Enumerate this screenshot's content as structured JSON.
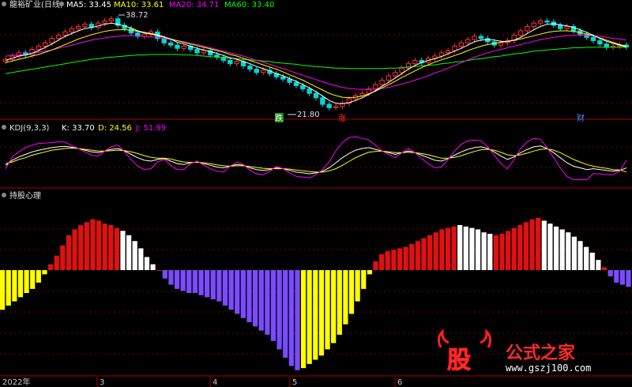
{
  "header": {
    "stock": "龍裕矿业(日线)",
    "ma5": "MA5: 33.45",
    "ma10": "MA10: 33.61",
    "ma20": "MA20: 34.71",
    "ma60": "MA60: 33.40",
    "high_label": "38.72",
    "low_label": "21.80",
    "markers": [
      "跌",
      "涨",
      "财"
    ]
  },
  "kdj": {
    "title": "KDJ(9,3,3)",
    "k": "K: 33.70",
    "d": "D: 24.56",
    "j": "J: 51.99"
  },
  "indicator": {
    "title": "持股心理"
  },
  "date_axis": [
    "2022年",
    "3",
    "4",
    "5",
    "6"
  ],
  "logo": {
    "char": "股",
    "text": "公式之家",
    "url": "www.gszj100.com"
  },
  "colors": {
    "up": "#ff3030",
    "down": "#00d8d8",
    "ma5": "#ffffff",
    "ma10": "#ffff00",
    "ma20": "#ff00ff",
    "ma60": "#00ff00",
    "hist_pos": "#e01010",
    "hist_pos_weak": "#ffffff",
    "hist_neg": "#7a4cff",
    "hist_neg_weak": "#ffff00",
    "divider": "#aa0000"
  },
  "chart_data": [
    {
      "type": "candlestick",
      "title": "",
      "note": "daily price panel with moving averages",
      "high": 38.72,
      "low": 21.8,
      "ylim": [
        21.0,
        40.0
      ],
      "close": [
        31.2,
        31.8,
        32.4,
        32.0,
        33.0,
        33.6,
        34.2,
        35.0,
        35.6,
        36.2,
        36.8,
        37.2,
        37.6,
        37.0,
        37.8,
        38.2,
        38.6,
        37.4,
        36.8,
        36.0,
        35.4,
        35.8,
        36.2,
        35.0,
        34.2,
        33.8,
        33.2,
        33.6,
        33.0,
        32.4,
        32.8,
        32.0,
        31.6,
        31.0,
        30.4,
        30.8,
        30.0,
        29.4,
        28.8,
        29.2,
        28.6,
        28.0,
        27.6,
        27.0,
        26.4,
        25.8,
        25.0,
        24.2,
        23.0,
        22.4,
        22.6,
        23.2,
        24.0,
        24.6,
        25.0,
        25.8,
        26.6,
        27.4,
        28.2,
        28.8,
        29.6,
        30.4,
        31.0,
        30.6,
        31.4,
        31.8,
        32.4,
        32.8,
        33.6,
        34.2,
        34.8,
        35.4,
        35.0,
        34.4,
        33.8,
        34.2,
        34.6,
        35.6,
        36.4,
        37.2,
        37.8,
        38.2,
        38.0,
        37.4,
        36.8,
        37.2,
        36.4,
        35.8,
        35.2,
        34.6,
        34.0,
        33.4,
        33.6,
        33.8,
        33.45
      ],
      "ma5": [
        31.0,
        31.4,
        31.8,
        32.0,
        32.3,
        32.8,
        33.4,
        34.0,
        34.7,
        35.4,
        35.9,
        36.4,
        36.8,
        37.0,
        37.3,
        37.6,
        37.8,
        37.6,
        37.3,
        36.9,
        36.4,
        36.1,
        35.9,
        35.7,
        35.3,
        34.9,
        34.3,
        34.0,
        33.6,
        33.2,
        32.9,
        32.6,
        32.3,
        31.9,
        31.5,
        31.2,
        30.8,
        30.4,
        29.9,
        29.5,
        29.1,
        28.6,
        28.2,
        27.7,
        27.2,
        26.6,
        26.0,
        25.3,
        24.5,
        23.7,
        23.2,
        23.1,
        23.3,
        23.7,
        24.2,
        24.8,
        25.5,
        26.3,
        27.0,
        27.8,
        28.6,
        29.4,
        30.1,
        30.6,
        31.0,
        31.3,
        31.7,
        32.2,
        32.7,
        33.2,
        33.8,
        34.4,
        34.7,
        34.8,
        34.7,
        34.5,
        34.4,
        34.7,
        35.2,
        35.9,
        36.6,
        37.2,
        37.6,
        37.7,
        37.5,
        37.3,
        37.0,
        36.6,
        36.1,
        35.6,
        35.0,
        34.5,
        34.1,
        33.8,
        33.45
      ],
      "ma10": [
        30.6,
        30.9,
        31.2,
        31.5,
        31.8,
        32.1,
        32.5,
        32.9,
        33.4,
        33.9,
        34.4,
        34.9,
        35.3,
        35.7,
        36.0,
        36.3,
        36.5,
        36.6,
        36.6,
        36.5,
        36.3,
        36.0,
        35.8,
        35.5,
        35.2,
        34.9,
        34.6,
        34.3,
        34.0,
        33.7,
        33.4,
        33.1,
        32.8,
        32.5,
        32.1,
        31.8,
        31.4,
        31.0,
        30.6,
        30.2,
        29.8,
        29.4,
        28.9,
        28.4,
        27.9,
        27.4,
        26.8,
        26.2,
        25.6,
        25.0,
        24.6,
        24.3,
        24.2,
        24.3,
        24.5,
        24.9,
        25.4,
        26.0,
        26.6,
        27.2,
        27.9,
        28.5,
        29.1,
        29.7,
        30.2,
        30.7,
        31.1,
        31.5,
        31.9,
        32.3,
        32.8,
        33.2,
        33.6,
        33.9,
        34.1,
        34.3,
        34.5,
        34.7,
        34.9,
        35.2,
        35.5,
        35.8,
        36.1,
        36.3,
        36.4,
        36.4,
        36.3,
        36.1,
        35.8,
        35.5,
        35.1,
        34.7,
        34.3,
        33.9,
        33.61
      ],
      "ma20": [
        31.8,
        31.9,
        32.0,
        32.1,
        32.3,
        32.5,
        32.7,
        32.9,
        33.2,
        33.5,
        33.8,
        34.1,
        34.4,
        34.7,
        34.9,
        35.1,
        35.3,
        35.4,
        35.5,
        35.5,
        35.5,
        35.4,
        35.3,
        35.2,
        35.0,
        34.8,
        34.6,
        34.4,
        34.1,
        33.9,
        33.6,
        33.3,
        33.0,
        32.7,
        32.4,
        32.1,
        31.8,
        31.4,
        31.0,
        30.7,
        30.3,
        29.9,
        29.5,
        29.1,
        28.7,
        28.3,
        27.9,
        27.5,
        27.1,
        26.7,
        26.4,
        26.1,
        25.9,
        25.8,
        25.7,
        25.7,
        25.8,
        25.9,
        26.1,
        26.4,
        26.7,
        27.0,
        27.4,
        27.8,
        28.2,
        28.7,
        29.1,
        29.6,
        30.1,
        30.6,
        31.1,
        31.6,
        32.0,
        32.4,
        32.7,
        33.0,
        33.3,
        33.6,
        33.9,
        34.2,
        34.5,
        34.8,
        35.0,
        35.2,
        35.4,
        35.5,
        35.6,
        35.6,
        35.6,
        35.5,
        35.4,
        35.2,
        35.0,
        34.9,
        34.71
      ],
      "ma60": [
        28.6,
        28.8,
        29.0,
        29.2,
        29.4,
        29.6,
        29.8,
        30.0,
        30.2,
        30.4,
        30.6,
        30.8,
        31.0,
        31.2,
        31.3,
        31.5,
        31.6,
        31.7,
        31.8,
        31.9,
        32.0,
        32.0,
        32.1,
        32.1,
        32.1,
        32.1,
        32.1,
        32.0,
        32.0,
        31.9,
        31.8,
        31.7,
        31.6,
        31.5,
        31.4,
        31.3,
        31.2,
        31.1,
        31.0,
        30.9,
        30.8,
        30.6,
        30.5,
        30.4,
        30.3,
        30.1,
        30.0,
        29.9,
        29.8,
        29.7,
        29.6,
        29.6,
        29.5,
        29.5,
        29.5,
        29.5,
        29.5,
        29.5,
        29.6,
        29.6,
        29.7,
        29.8,
        29.9,
        30.0,
        30.1,
        30.2,
        30.4,
        30.5,
        30.7,
        30.8,
        31.0,
        31.2,
        31.3,
        31.5,
        31.7,
        31.8,
        32.0,
        32.2,
        32.3,
        32.5,
        32.7,
        32.8,
        32.9,
        33.0,
        33.1,
        33.2,
        33.3,
        33.3,
        33.4,
        33.4,
        33.4,
        33.4,
        33.4,
        33.4,
        33.4
      ]
    },
    {
      "type": "line",
      "title": "KDJ(9,3,3)",
      "ylim": [
        -10,
        110
      ],
      "series": [
        {
          "name": "K",
          "values": [
            40,
            52,
            60,
            66,
            72,
            76,
            79,
            82,
            84,
            85,
            83,
            80,
            76,
            72,
            70,
            74,
            78,
            80,
            74,
            66,
            58,
            52,
            50,
            54,
            56,
            50,
            44,
            42,
            46,
            48,
            44,
            40,
            36,
            34,
            38,
            42,
            40,
            34,
            30,
            28,
            30,
            34,
            32,
            28,
            24,
            22,
            20,
            22,
            26,
            34,
            46,
            58,
            68,
            76,
            80,
            82,
            78,
            74,
            70,
            66,
            70,
            74,
            70,
            64,
            58,
            52,
            50,
            56,
            64,
            72,
            78,
            82,
            84,
            80,
            72,
            62,
            54,
            60,
            70,
            78,
            84,
            86,
            80,
            70,
            58,
            46,
            38,
            34,
            30,
            32,
            30,
            28,
            26,
            28,
            33.7
          ]
        },
        {
          "name": "D",
          "values": [
            44,
            48,
            54,
            58,
            64,
            68,
            72,
            76,
            78,
            80,
            81,
            80,
            78,
            76,
            74,
            74,
            75,
            76,
            75,
            72,
            68,
            63,
            59,
            57,
            57,
            55,
            51,
            48,
            47,
            47,
            46,
            44,
            41,
            39,
            38,
            39,
            39,
            37,
            35,
            33,
            32,
            32,
            32,
            31,
            29,
            27,
            25,
            24,
            24,
            27,
            32,
            40,
            49,
            58,
            65,
            71,
            73,
            74,
            72,
            70,
            70,
            71,
            70,
            68,
            65,
            61,
            57,
            57,
            59,
            63,
            68,
            73,
            77,
            78,
            76,
            71,
            65,
            63,
            65,
            69,
            74,
            78,
            79,
            76,
            70,
            62,
            54,
            48,
            42,
            38,
            35,
            33,
            30,
            29,
            24.56
          ]
        },
        {
          "name": "J",
          "values": [
            32,
            60,
            72,
            82,
            88,
            92,
            93,
            94,
            96,
            95,
            87,
            80,
            72,
            64,
            62,
            74,
            84,
            88,
            72,
            54,
            38,
            30,
            32,
            48,
            54,
            40,
            30,
            30,
            44,
            50,
            40,
            32,
            26,
            24,
            38,
            48,
            42,
            28,
            20,
            18,
            26,
            38,
            32,
            22,
            14,
            12,
            10,
            18,
            30,
            48,
            74,
            94,
            106,
            108,
            104,
            100,
            88,
            74,
            66,
            58,
            70,
            80,
            70,
            56,
            44,
            34,
            36,
            54,
            74,
            90,
            98,
            100,
            98,
            84,
            64,
            44,
            32,
            54,
            80,
            96,
            104,
            102,
            82,
            58,
            34,
            14,
            6,
            6,
            6,
            20,
            20,
            18,
            18,
            26,
            51.99
          ]
        }
      ]
    },
    {
      "type": "bar",
      "title": "持股心理",
      "ylim": [
        -100,
        100
      ],
      "values": [
        -38,
        -34,
        -30,
        -26,
        -22,
        -18,
        -12,
        -4,
        8,
        20,
        34,
        48,
        56,
        62,
        66,
        70,
        68,
        64,
        62,
        58,
        54,
        48,
        40,
        30,
        18,
        8,
        0,
        -8,
        -14,
        -18,
        -20,
        -22,
        -22,
        -24,
        -26,
        -28,
        -30,
        -34,
        -38,
        -42,
        -46,
        -50,
        -54,
        -58,
        -62,
        -68,
        -76,
        -84,
        -92,
        -96,
        -94,
        -90,
        -86,
        -82,
        -76,
        -70,
        -62,
        -52,
        -42,
        -30,
        -18,
        -4,
        12,
        22,
        26,
        28,
        30,
        32,
        36,
        40,
        44,
        48,
        52,
        56,
        58,
        60,
        62,
        60,
        58,
        56,
        52,
        50,
        48,
        50,
        54,
        58,
        62,
        66,
        70,
        72,
        68,
        64,
        60,
        56,
        52,
        46,
        40,
        32,
        24,
        14,
        4,
        -6,
        -12,
        -14,
        -16
      ],
      "weak_flags": [
        1,
        1,
        1,
        1,
        1,
        1,
        1,
        1,
        0,
        0,
        0,
        0,
        0,
        0,
        0,
        0,
        0,
        0,
        0,
        0,
        1,
        1,
        1,
        1,
        1,
        1,
        0,
        0,
        0,
        0,
        0,
        0,
        0,
        0,
        0,
        0,
        0,
        0,
        0,
        0,
        0,
        0,
        0,
        0,
        0,
        0,
        0,
        0,
        0,
        0,
        1,
        1,
        1,
        1,
        1,
        1,
        1,
        1,
        1,
        1,
        1,
        1,
        0,
        0,
        0,
        0,
        0,
        0,
        0,
        0,
        0,
        0,
        0,
        0,
        0,
        0,
        1,
        1,
        1,
        1,
        1,
        1,
        0,
        0,
        0,
        0,
        0,
        0,
        0,
        0,
        1,
        1,
        1,
        1,
        1,
        1,
        1,
        1,
        1,
        1,
        0,
        0,
        0,
        0
      ]
    }
  ]
}
